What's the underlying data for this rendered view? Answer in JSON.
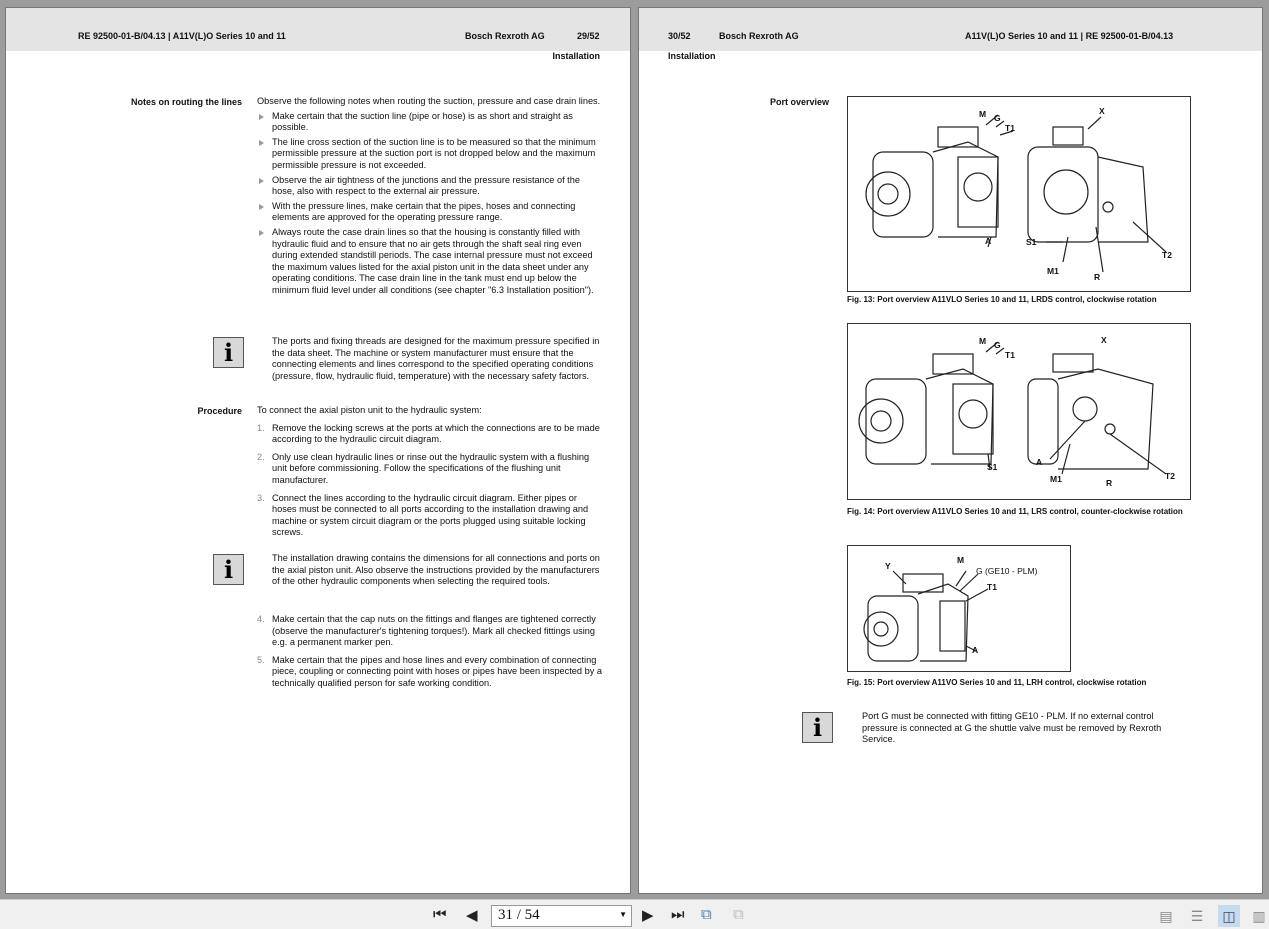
{
  "left_page": {
    "header": {
      "doc": "RE 92500-01-B/04.13  |  A11V(L)O Series 10 and 11",
      "company": "Bosch Rexroth AG",
      "page": "29/52"
    },
    "section": "Installation",
    "notes_heading": "Notes on routing the lines",
    "notes_intro": "Observe the following notes when routing the suction, pressure and case drain lines.",
    "bullets": [
      "Make certain that the suction line (pipe or hose) is as short and straight as possible.",
      "The line cross section of the suction line is to be measured so that the minimum permissible pressure at the suction port is not dropped below and the maximum permissible pressure is not exceeded.",
      "Observe the air tightness of the junctions and the pressure resistance of the hose, also with respect to the external air pressure.",
      "With the pressure lines, make certain that the pipes, hoses and connecting elements are approved for the operating pressure range.",
      "Always route the case drain lines so that the housing is constantly filled with hydraulic fluid and to ensure that no air gets through the shaft seal ring even during extended standstill periods. The case internal pressure must not exceed the maximum values listed for the axial piston unit in the data sheet under any operating conditions. The case drain line in the tank must end up below the minimum fluid level under all conditions (see chapter \"6.3 Installation position\")."
    ],
    "info1": "The ports and fixing threads are designed for the maximum pressure specified in the data sheet. The machine or system manufacturer must ensure that the connecting elements and lines correspond to the specified operating conditions (pressure, flow, hydraulic fluid, temperature) with the necessary safety factors.",
    "procedure_heading": "Procedure",
    "procedure_intro": "To connect the axial piston unit to the hydraulic system:",
    "steps_a": [
      {
        "n": "1.",
        "t": "Remove the locking screws at the ports at which the connections are to be made according to the hydraulic circuit diagram."
      },
      {
        "n": "2.",
        "t": "Only use clean hydraulic lines or rinse out the hydraulic system with a flushing unit before commissioning. Follow the specifications of the flushing unit manufacturer."
      },
      {
        "n": "3.",
        "t": "Connect the lines according to the hydraulic circuit diagram. Either pipes or hoses must be connected to all ports according to the installation drawing and machine or system circuit diagram or the ports plugged using suitable locking screws."
      }
    ],
    "info2": "The installation drawing contains the dimensions for all connections and ports on the axial piston unit. Also observe the instructions provided by the manufacturers of the other hydraulic components when selecting the required tools.",
    "steps_b": [
      {
        "n": "4.",
        "t": "Make certain that the cap nuts on the fittings and flanges are tightened correctly (observe the manufacturer's tightening torques!). Mark all checked fittings using e.g. a permanent marker pen."
      },
      {
        "n": "5.",
        "t": "Make certain that the pipes and hose lines and every combination of connecting piece, coupling or connecting point with hoses or pipes have been inspected by a technically qualified person for safe working condition."
      }
    ]
  },
  "right_page": {
    "header": {
      "page": "30/52",
      "company": "Bosch Rexroth AG",
      "doc": "A11V(L)O Series 10 and 11  |  RE 92500-01-B/04.13"
    },
    "section": "Installation",
    "port_overview": "Port overview",
    "fig13": {
      "caption": "Fig. 13: Port overview A11VLO Series 10 and 11, LRDS control, clockwise rotation",
      "labels": [
        "M",
        "G",
        "T1",
        "X",
        "A",
        "S1",
        "M1",
        "R",
        "T2"
      ]
    },
    "fig14": {
      "caption": "Fig. 14: Port overview A11VLO Series 10 and 11, LRS control, counter-clockwise rotation",
      "labels": [
        "M",
        "G",
        "T1",
        "X",
        "S1",
        "A",
        "M1",
        "R",
        "T2"
      ]
    },
    "fig15": {
      "caption": "Fig. 15: Port overview A11VO Series 10 and 11, LRH control, clockwise rotation",
      "labels": [
        "Y",
        "M",
        "G (GE10 - PLM)",
        "T1",
        "A"
      ]
    },
    "info": "Port G must be connected with fitting GE10 - PLM. If no external control pressure is connected at G the shuttle valve must be removed by Rexroth Service."
  },
  "toolbar": {
    "page_value": "31 / 54",
    "info_icon": "i"
  }
}
